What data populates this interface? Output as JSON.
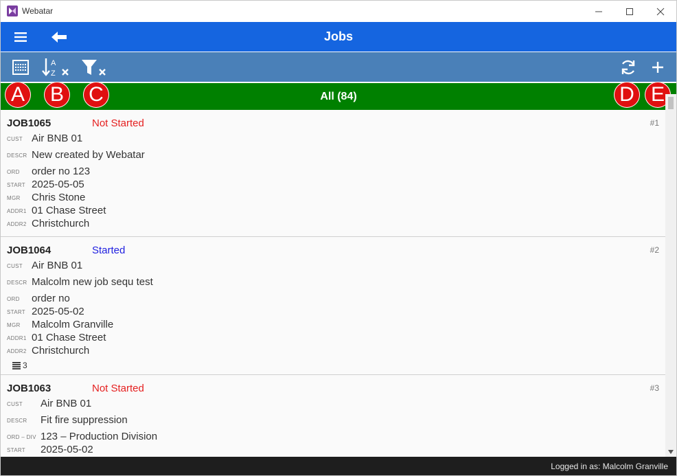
{
  "window": {
    "app_name": "Webatar"
  },
  "header": {
    "title": "Jobs"
  },
  "filter": {
    "label": "All (84)"
  },
  "markers": [
    "A",
    "B",
    "C",
    "D",
    "E"
  ],
  "jobs": [
    {
      "id": "JOB1065",
      "status": "Not Started",
      "status_color": "#e52020",
      "index": "#1",
      "fields": [
        {
          "label": "CUST",
          "value": "Air BNB 01"
        },
        {
          "label": "DESCR",
          "value": "New created by Webatar"
        },
        {
          "label": "ORD",
          "value": "order no 123"
        },
        {
          "label": "START",
          "value": "2025-05-05"
        },
        {
          "label": "MGR",
          "value": "Chris Stone"
        },
        {
          "label": "ADDR1",
          "value": "01 Chase Street"
        },
        {
          "label": "ADDR2",
          "value": "Christchurch"
        }
      ]
    },
    {
      "id": "JOB1064",
      "status": "Started",
      "status_color": "#2020e0",
      "index": "#2",
      "fields": [
        {
          "label": "CUST",
          "value": "Air BNB 01"
        },
        {
          "label": "DESCR",
          "value": "Malcolm new job sequ test"
        },
        {
          "label": "ORD",
          "value": "order no"
        },
        {
          "label": "START",
          "value": "2025-05-02"
        },
        {
          "label": "MGR",
          "value": "Malcolm Granville"
        },
        {
          "label": "ADDR1",
          "value": "01 Chase Street"
        },
        {
          "label": "ADDR2",
          "value": "Christchurch"
        }
      ],
      "notes_count": "3"
    },
    {
      "id": "JOB1063",
      "status": "Not Started",
      "status_color": "#e52020",
      "index": "#3",
      "fields": [
        {
          "label": "CUST",
          "value": "Air BNB 01"
        },
        {
          "label": "DESCR",
          "value": "Fit fire suppression"
        },
        {
          "label": "ORD – DIV",
          "value": "123 – Production Division"
        },
        {
          "label": "START",
          "value": "2025-05-02"
        }
      ]
    }
  ],
  "statusbar": {
    "logged_in": "Logged in as: Malcolm Granville"
  },
  "icons": {
    "toolbar": [
      "grid-select-icon",
      "sort-clear-icon",
      "filter-clear-icon",
      "refresh-icon",
      "add-icon"
    ],
    "header": [
      "menu-icon",
      "back-arrow-icon"
    ],
    "notes": "list-icon"
  },
  "colors": {
    "header": "#1565e0",
    "toolbar": "#4a80b8",
    "filterbar": "#008000",
    "marker": "#e01010",
    "statusbar": "#1e1e1e"
  }
}
